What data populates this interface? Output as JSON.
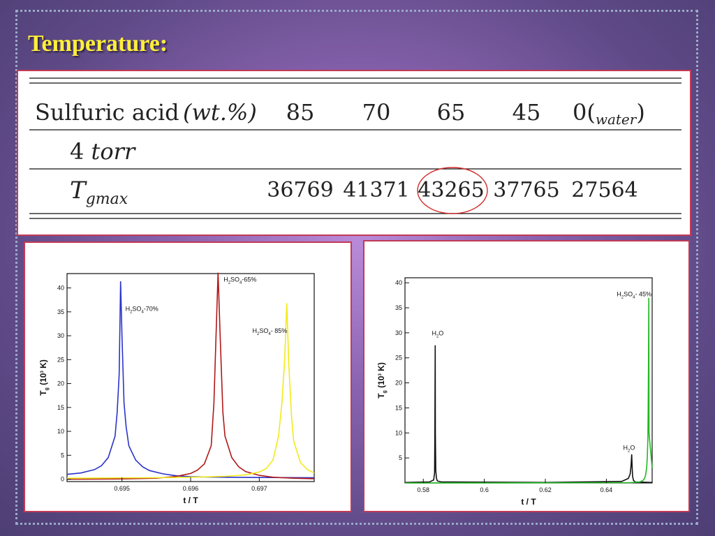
{
  "slide": {
    "title": "Temperature:"
  },
  "table": {
    "row1": {
      "label_roman": "Sulfuric acid",
      "label_unit": "(wt.%)",
      "values": [
        "85",
        "70",
        "65",
        "45"
      ],
      "last_prefix": "0(",
      "last_sub": "water",
      "last_suffix": ")"
    },
    "row2": {
      "label_num": "4",
      "label_unit": "torr"
    },
    "row3": {
      "label_main": "T",
      "label_sub": "gmax",
      "values": [
        "36769",
        "41371",
        "43265",
        "37765",
        "27564"
      ]
    },
    "highlight_color": "#d22b2b"
  },
  "chart_data": [
    {
      "type": "line",
      "xlabel": "t / T",
      "ylabel_prefix": "T",
      "ylabel_sub": "g",
      "ylabel_mid": " (10",
      "ylabel_sup": "3",
      "ylabel_suffix": " K)",
      "xlim": [
        0.6942,
        0.6978
      ],
      "ylim": [
        -0.5,
        43
      ],
      "xticks": [
        0.695,
        0.696,
        0.697
      ],
      "yticks": [
        0,
        5,
        10,
        15,
        20,
        25,
        30,
        35,
        40
      ],
      "series": [
        {
          "name": "H2SO4-70%",
          "color": "#2b33c8",
          "x": [
            0.6942,
            0.6944,
            0.6946,
            0.6947,
            0.6948,
            0.6949,
            0.69493,
            0.69496,
            0.69498,
            0.695,
            0.69503,
            0.69506,
            0.6951,
            0.6952,
            0.6953,
            0.6954,
            0.6956,
            0.6958,
            0.696,
            0.6965,
            0.697,
            0.6978
          ],
          "y": [
            1,
            1.3,
            2,
            2.8,
            4.5,
            9,
            14,
            22,
            41.4,
            30,
            16,
            11,
            7,
            4,
            2.6,
            1.8,
            1.1,
            0.7,
            0.5,
            0.4,
            0.35,
            0.3
          ]
        },
        {
          "name": "H2SO4-65%",
          "color": "#b01818",
          "x": [
            0.6942,
            0.695,
            0.6955,
            0.6958,
            0.696,
            0.6961,
            0.6962,
            0.6963,
            0.69634,
            0.69637,
            0.6964,
            0.69643,
            0.69647,
            0.6965,
            0.6966,
            0.6967,
            0.6968,
            0.697,
            0.6972,
            0.6975,
            0.6978
          ],
          "y": [
            0,
            0.05,
            0.2,
            0.6,
            1.2,
            1.9,
            3.2,
            7,
            16,
            30,
            43.2,
            30,
            14,
            9,
            4.5,
            2.6,
            1.6,
            0.8,
            0.4,
            0.2,
            0.1
          ]
        },
        {
          "name": "H2SO4-85%",
          "color": "#f2ea1a",
          "x": [
            0.6942,
            0.6955,
            0.696,
            0.6965,
            0.6968,
            0.697,
            0.6971,
            0.6972,
            0.69728,
            0.69733,
            0.69737,
            0.6974,
            0.69743,
            0.69747,
            0.6975,
            0.6976,
            0.6977,
            0.6978
          ],
          "y": [
            0.2,
            0.3,
            0.4,
            0.6,
            0.9,
            1.5,
            2.2,
            4,
            9,
            16,
            25,
            36.8,
            24,
            13,
            8,
            3.5,
            2,
            1.3
          ]
        }
      ],
      "annotations": [
        {
          "text_pre": "H",
          "sub1": "2",
          "mid": "SO",
          "sub2": "4",
          "post": "-70%",
          "at": [
            0.69505,
            35.2
          ]
        },
        {
          "text_pre": "H",
          "sub1": "2",
          "mid": "SO",
          "sub2": "4",
          "post": "-65%",
          "at": [
            0.69648,
            41.3
          ]
        },
        {
          "text_pre": "H",
          "sub1": "2",
          "mid": "SO",
          "sub2": "4",
          "post": "- 85%",
          "at": [
            0.6969,
            30.6
          ]
        }
      ]
    },
    {
      "type": "line",
      "xlabel": "t / T",
      "ylabel_prefix": "T",
      "ylabel_sub": "g",
      "ylabel_mid": " (10",
      "ylabel_sup": "3",
      "ylabel_suffix": " K)",
      "xlim": [
        0.574,
        0.655
      ],
      "ylim": [
        0,
        41
      ],
      "xticks": [
        0.58,
        0.6,
        0.62,
        0.64
      ],
      "xtick_labels": [
        "0.58",
        "0.6",
        "0.62",
        "0.64"
      ],
      "yticks": [
        5,
        10,
        15,
        20,
        25,
        30,
        35,
        40
      ],
      "series": [
        {
          "name": "H2O",
          "color": "#111111",
          "x": [
            0.574,
            0.582,
            0.5834,
            0.5837,
            0.5838,
            0.5839,
            0.58395,
            0.5841,
            0.5843,
            0.5846,
            0.586,
            0.62,
            0.645,
            0.6472,
            0.6478,
            0.6481,
            0.6483,
            0.64845,
            0.6486,
            0.6489,
            0.6495,
            0.655
          ],
          "y": [
            0.1,
            0.2,
            0.6,
            2,
            10,
            27.5,
            10,
            2.5,
            1,
            0.4,
            0.2,
            0.1,
            0.3,
            0.9,
            1.8,
            3.5,
            5.7,
            3,
            1.3,
            0.5,
            0.2,
            0.1
          ]
        },
        {
          "name": "H2SO4-45%",
          "color": "#22b822",
          "x": [
            0.574,
            0.648,
            0.651,
            0.652,
            0.6525,
            0.6529,
            0.6532,
            0.6534,
            0.6536,
            0.6537,
            0.6538,
            0.6539,
            0.65393,
            0.65396,
            0.655
          ],
          "y": [
            0,
            0.05,
            0.2,
            0.5,
            0.9,
            1.7,
            3,
            5,
            9,
            15,
            25,
            37,
            28,
            10,
            3
          ]
        }
      ],
      "annotations": [
        {
          "text_pre": "H",
          "sub1": "2",
          "mid": "O",
          "sub2": "",
          "post": "",
          "at": [
            0.5828,
            29.5
          ]
        },
        {
          "text_pre": "H",
          "sub1": "2",
          "mid": "SO",
          "sub2": "4",
          "post": "- 45%",
          "at": [
            0.6434,
            37.3
          ]
        },
        {
          "text_pre": "H",
          "sub1": "2",
          "mid": "O",
          "sub2": "",
          "post": "",
          "at": [
            0.6455,
            6.6
          ]
        }
      ]
    }
  ]
}
